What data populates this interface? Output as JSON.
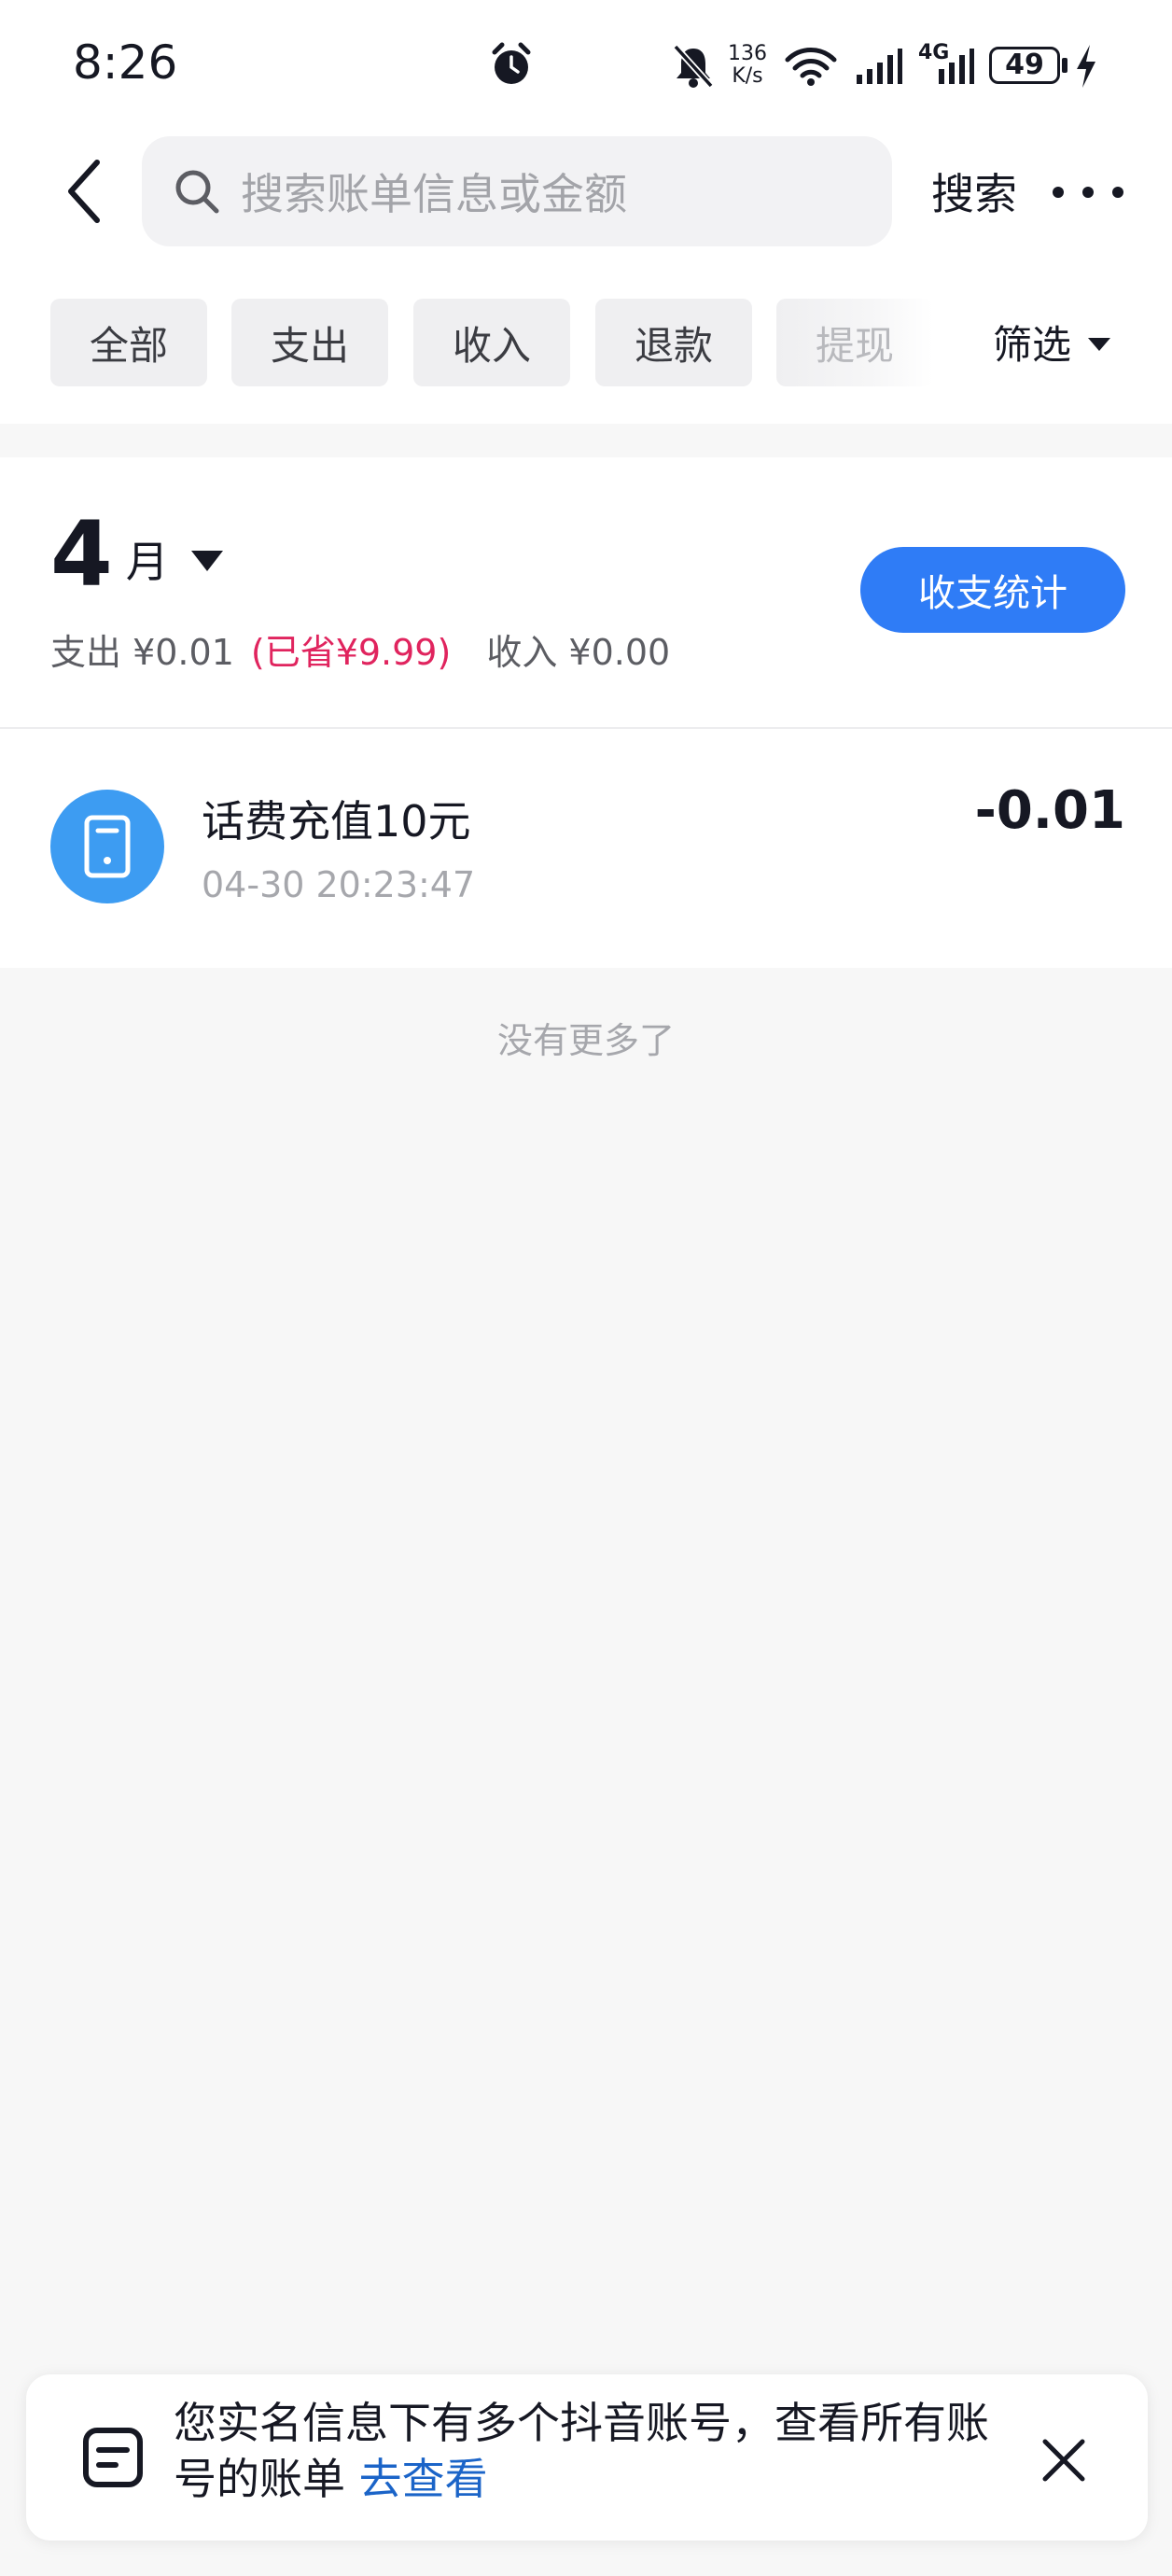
{
  "status_bar": {
    "time": "8:26",
    "net_speed_value": "136",
    "net_speed_unit": "K/s",
    "network_type": "4G",
    "battery": "49"
  },
  "header": {
    "search_placeholder": "搜索账单信息或金额",
    "search_button": "搜索"
  },
  "filter_tabs": [
    "全部",
    "支出",
    "收入",
    "退款",
    "提现"
  ],
  "filter_button": "筛选",
  "month_section": {
    "month_number": "4",
    "month_unit": "月",
    "expense": "支出 ¥0.01",
    "saved": "(已省¥9.99)",
    "income": "收入 ¥0.00",
    "stats_button": "收支统计"
  },
  "transactions": [
    {
      "title": "话费充值10元",
      "time": "04-30 20:23:47",
      "amount": "-0.01",
      "icon": "phone-icon"
    }
  ],
  "list_end_text": "没有更多了",
  "banner": {
    "text": "您实名信息下有多个抖音账号，查看所有账号的账单",
    "link": "去查看"
  },
  "colors": {
    "accent_blue": "#2f7cf6",
    "saved_red": "#e0245e",
    "icon_blue": "#3d9cf2",
    "link_blue": "#1b64c8"
  }
}
